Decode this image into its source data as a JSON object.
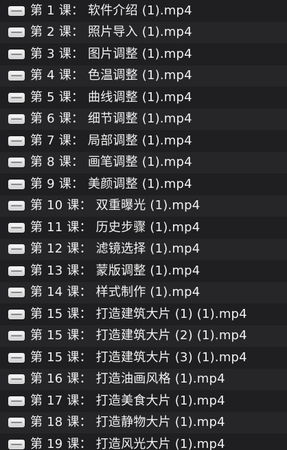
{
  "file_list": {
    "items": [
      {
        "name": "第 1 课： 软件介绍 (1).mp4",
        "icon": "video-file-icon"
      },
      {
        "name": "第 2 课： 照片导入 (1).mp4",
        "icon": "video-file-icon"
      },
      {
        "name": "第 3 课： 图片调整 (1).mp4",
        "icon": "video-file-icon"
      },
      {
        "name": "第 4 课： 色温调整 (1).mp4",
        "icon": "video-file-icon"
      },
      {
        "name": "第 5 课： 曲线调整 (1).mp4",
        "icon": "video-file-icon"
      },
      {
        "name": "第 6 课： 细节调整 (1).mp4",
        "icon": "video-file-icon"
      },
      {
        "name": "第 7 课： 局部调整 (1).mp4",
        "icon": "video-file-icon"
      },
      {
        "name": "第 8 课： 画笔调整 (1).mp4",
        "icon": "video-file-icon"
      },
      {
        "name": "第 9 课： 美颜调整 (1).mp4",
        "icon": "video-file-icon"
      },
      {
        "name": "第 10 课： 双重曝光 (1).mp4",
        "icon": "video-file-icon"
      },
      {
        "name": "第 11 课： 历史步骤 (1).mp4",
        "icon": "video-file-icon"
      },
      {
        "name": "第 12 课： 滤镜选择 (1).mp4",
        "icon": "video-file-icon"
      },
      {
        "name": "第 13 课： 蒙版调整 (1).mp4",
        "icon": "video-file-icon"
      },
      {
        "name": "第 14 课： 样式制作 (1).mp4",
        "icon": "video-file-icon"
      },
      {
        "name": "第 15 课： 打造建筑大片 (1) (1).mp4",
        "icon": "video-file-icon"
      },
      {
        "name": "第 15 课： 打造建筑大片 (2) (1).mp4",
        "icon": "video-file-icon"
      },
      {
        "name": "第 15 课： 打造建筑大片 (3) (1).mp4",
        "icon": "video-file-icon"
      },
      {
        "name": "第 16 课： 打造油画风格 (1).mp4",
        "icon": "video-file-icon"
      },
      {
        "name": "第 17 课： 打造美食大片 (1).mp4",
        "icon": "video-file-icon"
      },
      {
        "name": "第 18 课： 打造静物大片 (1).mp4",
        "icon": "video-file-icon"
      },
      {
        "name": "第 19 课： 打造风光大片 (1).mp4",
        "icon": "video-file-icon"
      }
    ]
  }
}
